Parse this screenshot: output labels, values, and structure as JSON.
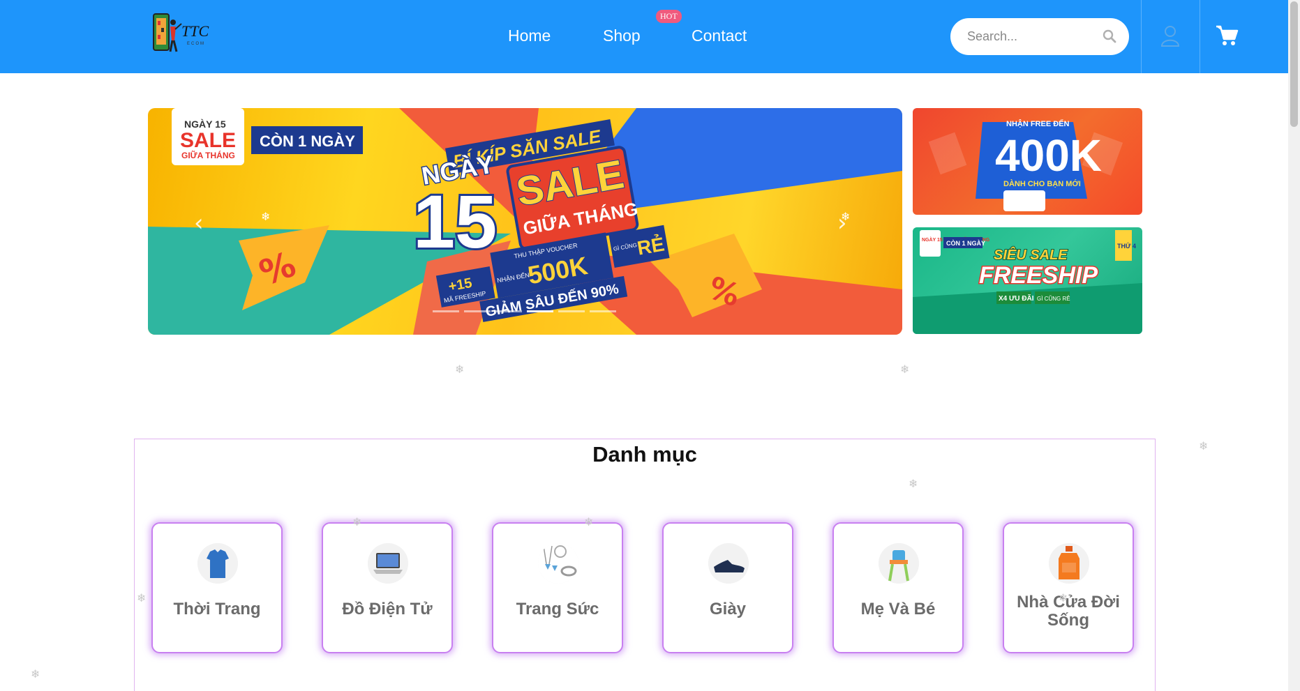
{
  "header": {
    "logo_text": "TTC",
    "logo_sub": "ECOM",
    "nav": [
      {
        "label": "Home"
      },
      {
        "label": "Shop",
        "badge": "HOT"
      },
      {
        "label": "Contact"
      }
    ],
    "search_placeholder": "Search...",
    "icons": [
      "search-icon",
      "user-icon",
      "cart-icon"
    ],
    "accent_color": "#1e95fb",
    "badge_color": "#f05a7e"
  },
  "main_banner": {
    "corner_badge": {
      "line1": "NGÀY 15",
      "line2": "SALE",
      "line3": "GIỮA THÁNG"
    },
    "countdown": "CÒN 1 NGÀY",
    "headline": "BÍ KÍP SĂN SALE",
    "day_label": "NGÀY",
    "day_number": "15",
    "sale_word": "SALE",
    "sale_sub": "GIỮA THÁNG",
    "freeship_value": "+15",
    "freeship_label": "MÃ FREESHIP",
    "voucher_caption": "THU THẬP VOUCHER",
    "voucher_prefix": "NHẬN ĐẾN",
    "voucher_value": "500K",
    "cheap_prefix": "GÌ CŨNG",
    "cheap_word": "RẺ",
    "discount": "GIẢM SÂU ĐẾN 90%",
    "prev_icon": "chevron-left-icon",
    "next_icon": "chevron-right-icon",
    "slide_count": 6,
    "active_slide": 3
  },
  "side_banners": [
    {
      "line1": "NHẬN FREE ĐẾN",
      "value": "400K",
      "line2": "DÀNH CHO BẠN MỚI"
    },
    {
      "badge": "NGÀY 15 SALE GIỮA THÁNG",
      "countdown": "CÒN 1 NGÀY",
      "line1": "SIÊU SALE",
      "line2": "FREESHIP",
      "day_tag": "THỨ 4",
      "perk1": "X4 ƯU ĐÃI",
      "perk2": "GÌ CŨNG RẺ"
    }
  ],
  "categories": {
    "title": "Danh mục",
    "items": [
      {
        "name": "Thời Trang",
        "icon": "shirt-icon"
      },
      {
        "name": "Đồ Điện Tử",
        "icon": "laptop-icon"
      },
      {
        "name": "Trang Sức",
        "icon": "jewelry-icon"
      },
      {
        "name": "Giày",
        "icon": "shoe-icon"
      },
      {
        "name": "Mẹ Và Bé",
        "icon": "high-chair-icon"
      },
      {
        "name": "Nhà Cửa Đời Sống",
        "icon": "detergent-bottle-icon"
      }
    ]
  }
}
